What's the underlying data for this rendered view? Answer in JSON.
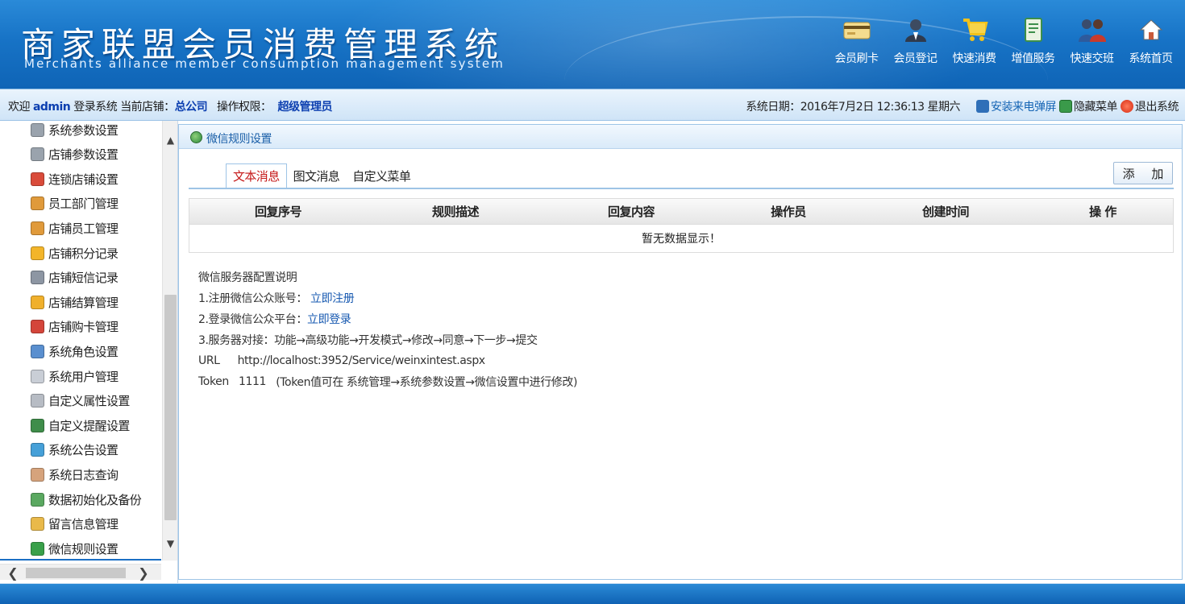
{
  "header": {
    "title": "商家联盟会员消费管理系统",
    "subtitle": "Merchants alliance member consumption management system",
    "nav": [
      {
        "label": "会员刷卡",
        "icon": "card-icon",
        "color": "#f1d98a"
      },
      {
        "label": "会员登记",
        "icon": "member-register-icon",
        "color": "#4a5a72"
      },
      {
        "label": "快速消费",
        "icon": "shopping-cart-icon",
        "color": "#f2c21a"
      },
      {
        "label": "增值服务",
        "icon": "value-added-service-icon",
        "color": "#3c8f4a"
      },
      {
        "label": "快速交班",
        "icon": "shift-handover-icon",
        "color": "#c83a2b"
      },
      {
        "label": "系统首页",
        "icon": "home-icon",
        "color": "#ffffff"
      }
    ]
  },
  "infobar": {
    "welcome": "欢迎",
    "username": "admin",
    "login_text": "登录系统",
    "store_label": "当前店铺：",
    "store_name": "总公司",
    "perm_label": "操作权限：",
    "perm_value": "超级管理员",
    "date_label": "系统日期：",
    "date_value": "2016年7月2日 12:36:13 星期六",
    "install_popup": "安装来电弹屏",
    "hide_menu": "隐藏菜单",
    "logout": "退出系统"
  },
  "sidebar": {
    "items": [
      {
        "label": "系统参数设置",
        "icon": "gear-icon",
        "color": "#9aa3ad"
      },
      {
        "label": "店铺参数设置",
        "icon": "gear-icon",
        "color": "#9aa3ad"
      },
      {
        "label": "连锁店铺设置",
        "icon": "chain-store-icon",
        "color": "#d94b3a"
      },
      {
        "label": "员工部门管理",
        "icon": "staff-icon",
        "color": "#e09a3b"
      },
      {
        "label": "店铺员工管理",
        "icon": "staff-icon",
        "color": "#e09a3b"
      },
      {
        "label": "店铺积分记录",
        "icon": "points-box-icon",
        "color": "#f3b52a"
      },
      {
        "label": "店铺短信记录",
        "icon": "phone-icon",
        "color": "#8d96a3"
      },
      {
        "label": "店铺结算管理",
        "icon": "settlement-icon",
        "color": "#f0b02c"
      },
      {
        "label": "店铺购卡管理",
        "icon": "card-purchase-icon",
        "color": "#d4453a"
      },
      {
        "label": "系统角色设置",
        "icon": "roles-icon",
        "color": "#5a8fcf"
      },
      {
        "label": "系统用户管理",
        "icon": "mouse-icon",
        "color": "#c9ced6"
      },
      {
        "label": "自定义属性设置",
        "icon": "property-icon",
        "color": "#b7bcc4"
      },
      {
        "label": "自定义提醒设置",
        "icon": "alarm-clock-icon",
        "color": "#3f8d4a"
      },
      {
        "label": "系统公告设置",
        "icon": "speaker-icon",
        "color": "#46a0d8"
      },
      {
        "label": "系统日志查询",
        "icon": "calendar-icon",
        "color": "#d6a37c"
      },
      {
        "label": "数据初始化及备份",
        "icon": "database-icon",
        "color": "#5aa860"
      },
      {
        "label": "留言信息管理",
        "icon": "message-icon",
        "color": "#e9b94a"
      },
      {
        "label": "微信规则设置",
        "icon": "wechat-icon",
        "color": "#39a04a"
      }
    ]
  },
  "panel": {
    "title": "微信规则设置",
    "tabs": [
      "文本消息",
      "图文消息",
      "自定义菜单"
    ],
    "active_tab": "文本消息",
    "add_button": "添 加",
    "columns": [
      "回复序号",
      "规则描述",
      "回复内容",
      "操作员",
      "创建时间",
      "操 作"
    ],
    "empty_text": "暂无数据显示！",
    "guide": {
      "heading": "微信服务器配置说明",
      "step1_text": "1.注册微信公众账号：",
      "step1_link": "立即注册",
      "step2_text": "2.登录微信公众平台：",
      "step2_link": "立即登录",
      "step3_text": "3.服务器对接：功能→高级功能→开发模式→修改→同意→下一步→提交",
      "url_label": "URL",
      "url_value": "http://localhost:3952/Service/weinxintest.aspx",
      "token_label": "Token",
      "token_value": "1111",
      "token_note": "(Token值可在 系统管理→系统参数设置→微信设置中进行修改)"
    }
  },
  "colors": {
    "header_blue": "#1773c6",
    "active_tab_red": "#c51818",
    "link_blue": "#1658b0"
  }
}
